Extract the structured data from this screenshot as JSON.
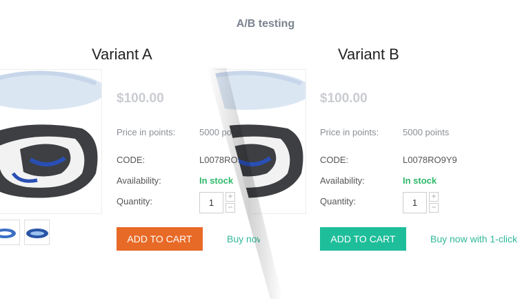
{
  "page": {
    "heading": "A/B testing"
  },
  "variant_a": {
    "title": "Variant A",
    "price": "$100.00",
    "points_label": "Price in points:",
    "points_value": "5000 po",
    "code_label": "CODE:",
    "code_value": "L0078RO9",
    "availability_label": "Availability:",
    "availability_value": "In stock",
    "quantity_label": "Quantity:",
    "quantity_value": "1",
    "plus": "+",
    "minus": "−",
    "add_to_cart": "ADD TO CART",
    "buy_now": "Buy now",
    "accent": "#e86a27"
  },
  "variant_b": {
    "title": "Variant B",
    "price": "$100.00",
    "points_label": "Price in points:",
    "points_value": "5000 points",
    "code_label": "CODE:",
    "code_value": "L0078RO9Y9",
    "availability_label": "Availability:",
    "availability_value": "In stock",
    "quantity_label": "Quantity:",
    "quantity_value": "1",
    "plus": "+",
    "minus": "−",
    "add_to_cart": "ADD TO CART",
    "buy_now": "Buy now with 1-click",
    "accent": "#1ebe9a"
  },
  "icons": {
    "product": "shoe-sole-image",
    "thumb": "shoe-thumbnail"
  }
}
